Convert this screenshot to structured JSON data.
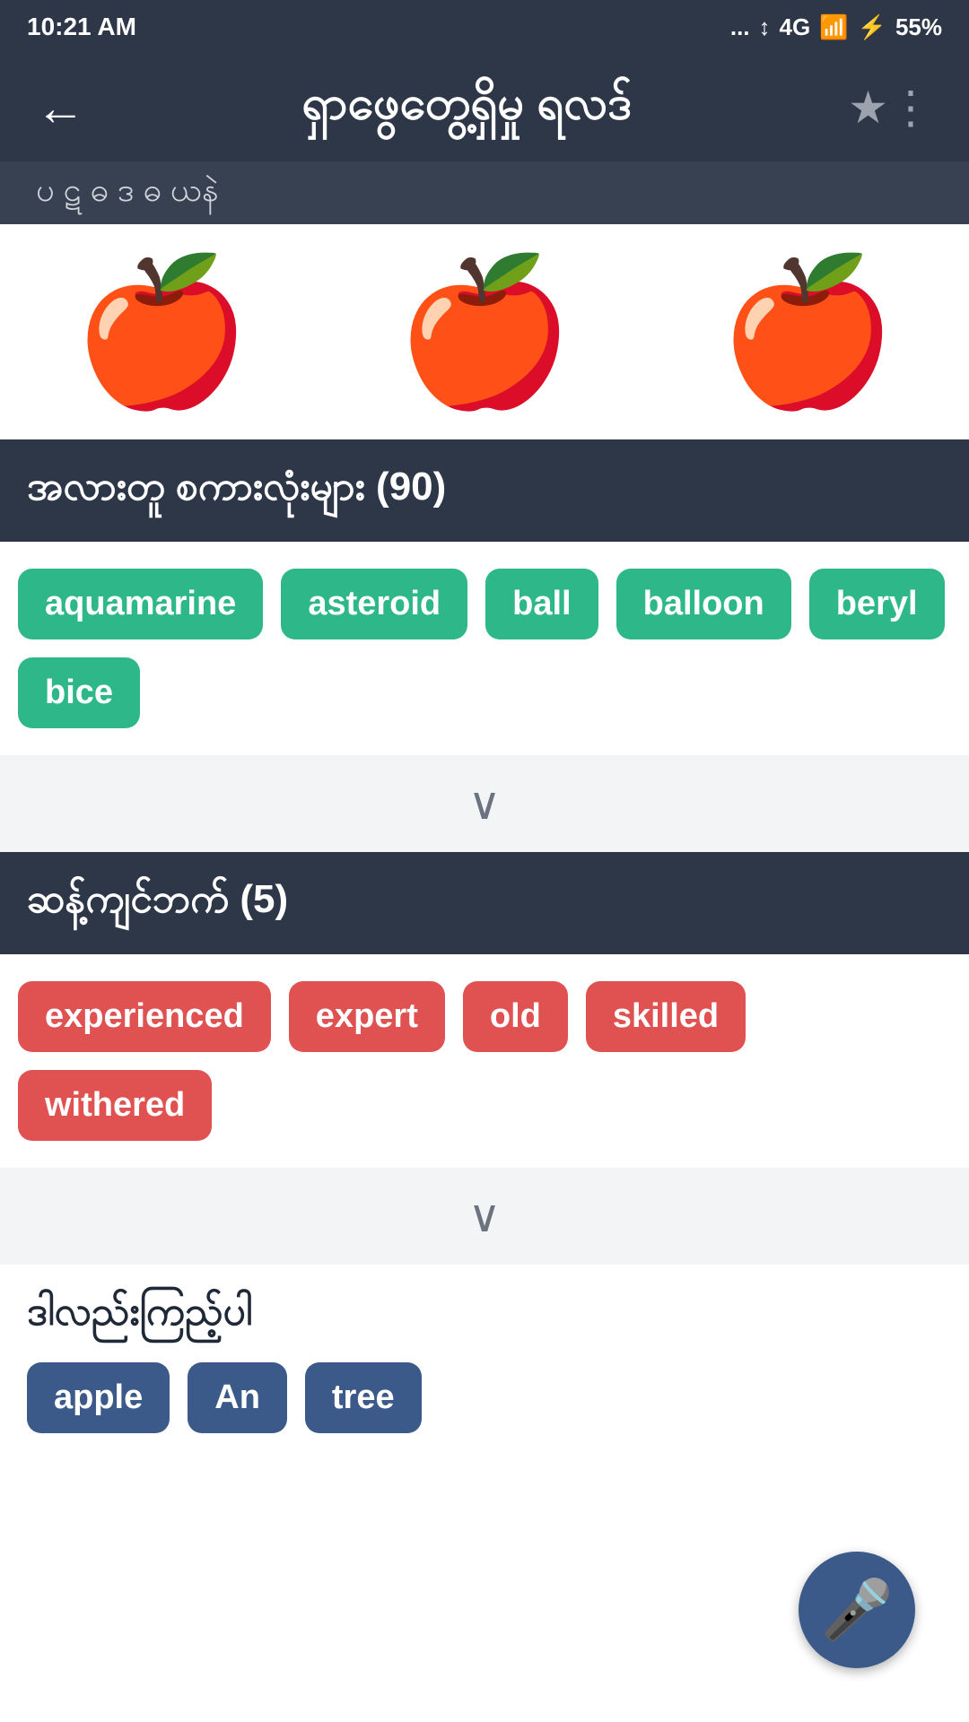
{
  "statusBar": {
    "time": "10:21 AM",
    "signal": "...",
    "network": "4G",
    "battery": "55%",
    "batteryIcon": "⚡"
  },
  "header": {
    "backLabel": "←",
    "title": "ရှာဖွေတွေ့ရှိမှု ရလဒ်",
    "starIcon": "★",
    "menuIcon": "⋮"
  },
  "subHeader": {
    "text": "ပ  ဋ  ဓ ဒ ဓ       ယနဲ"
  },
  "appleIcons": [
    "🍎",
    "🍎",
    "🍎"
  ],
  "relatedSection": {
    "title": "အလားတူ စကားလုံးများ (90)",
    "tags": [
      "aquamarine",
      "asteroid",
      "ball",
      "balloon",
      "beryl",
      "bice"
    ],
    "color": "teal",
    "expandIcon": "∨"
  },
  "synonymSection": {
    "title": "ဆန့်ကျင်ဘက် (5)",
    "tags": [
      "experienced",
      "expert",
      "old",
      "skilled",
      "withered"
    ],
    "color": "red",
    "expandIcon": "∨"
  },
  "bottomSection": {
    "title": "ဒါလည်းကြည့်ပါ",
    "tags": [
      "apple",
      "An",
      "tree"
    ],
    "color": "blue"
  },
  "fab": {
    "icon": "🎤",
    "label": "mic-button"
  }
}
